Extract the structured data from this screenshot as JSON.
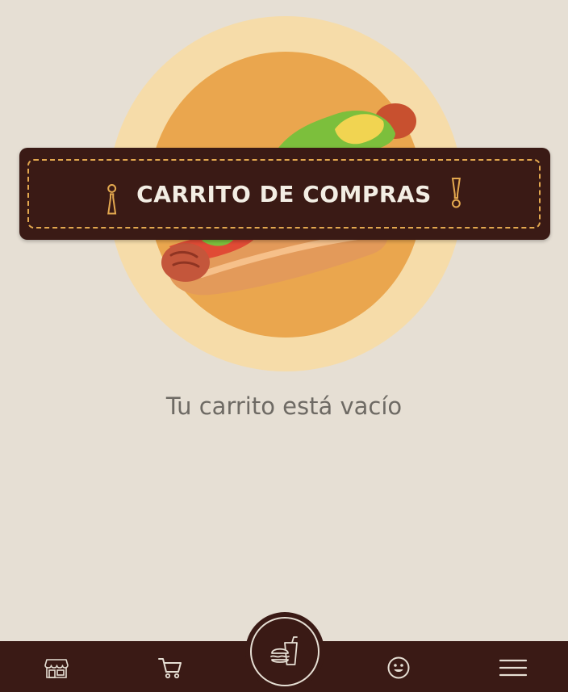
{
  "banner": {
    "title": "CARRITO DE COMPRAS",
    "open_mark": "¡",
    "close_mark": "!"
  },
  "cart": {
    "empty_message": "Tu carrito está vacío"
  },
  "nav": {
    "items": [
      {
        "icon": "store-icon"
      },
      {
        "icon": "cart-icon"
      },
      {
        "icon": "menu-burger-drink-icon"
      },
      {
        "icon": "smiley-icon"
      },
      {
        "icon": "hamburger-menu-icon"
      }
    ]
  },
  "colors": {
    "background": "#e6dfd4",
    "dark_brown": "#3a1a15",
    "accent_gold": "#e3a84f",
    "circle_light": "#f6dca9",
    "circle_orange": "#eaa64e",
    "text_gray": "#6e6a64"
  }
}
